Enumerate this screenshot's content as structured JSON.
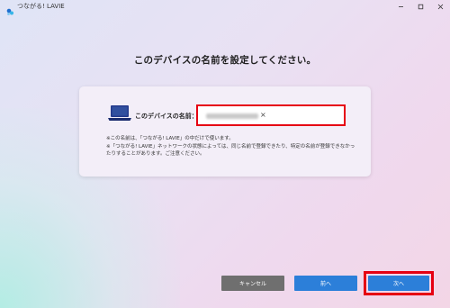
{
  "window": {
    "title": "つながる! LAVIE",
    "app_icon": "lavie-app-icon",
    "controls": [
      "minimize-icon",
      "maximize-icon",
      "close-icon"
    ]
  },
  "page": {
    "heading": "このデバイスの名前を設定してください。"
  },
  "form": {
    "device_icon": "laptop-icon",
    "label": "このデバイスの名前：",
    "input_clear": "×",
    "note_line1": "※この名前は、「つながる! LAVIE」の中だけで使います。",
    "note_line2": "※「つながる! LAVIE」ネットワークの状態によっては、同じ名前で登録できたり、特定の名前が登録できなかったりすることがあります。ご注意ください。"
  },
  "buttons": {
    "cancel": "キャンセル",
    "back": "前へ",
    "next": "次へ"
  },
  "colors": {
    "accent_blue": "#2c7fd9",
    "cancel_gray": "#6f6f6f",
    "highlight_red": "#e60012"
  }
}
